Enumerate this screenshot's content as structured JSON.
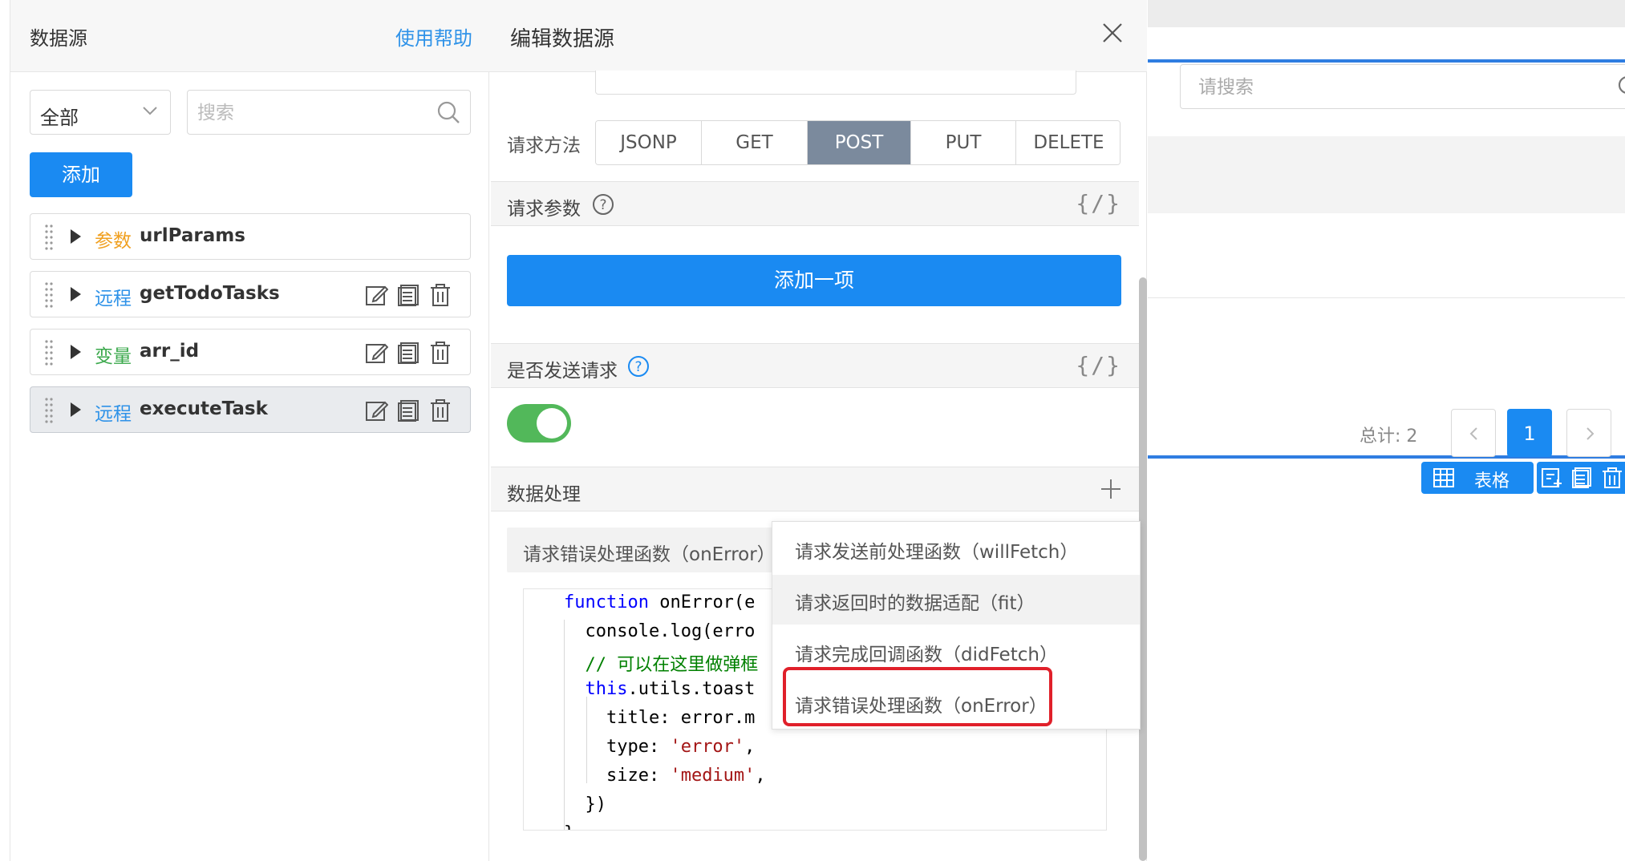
{
  "left": {
    "title": "数据源",
    "help": "使用帮助",
    "filter_value": "全部",
    "search_placeholder": "搜索",
    "add_button": "添加",
    "items": [
      {
        "kind": "参数",
        "kind_color": "#f0a020",
        "name": "urlParams",
        "has_actions": false
      },
      {
        "kind": "远程",
        "kind_color": "#2e92e8",
        "name": "getTodoTasks",
        "has_actions": true
      },
      {
        "kind": "变量",
        "kind_color": "#3aa84b",
        "name": "arr_id",
        "has_actions": true
      },
      {
        "kind": "远程",
        "kind_color": "#2e92e8",
        "name": "executeTask",
        "has_actions": true
      }
    ]
  },
  "editor": {
    "title": "编辑数据源",
    "method_label": "请求方法",
    "methods": [
      "JSONP",
      "GET",
      "POST",
      "PUT",
      "DELETE"
    ],
    "selected_method": "POST",
    "params_label": "请求参数",
    "code_toggle": "{/}",
    "add_item_button": "添加一项",
    "send_label": "是否发送请求",
    "send_enabled": true,
    "processing_label": "数据处理",
    "onerror_tab": "请求错误处理函数（onError）",
    "code_lines": [
      "function onError(e",
      "  console.log(erro",
      "  // 可以在这里做弹框",
      "  this.utils.toast",
      "    title: error.m",
      "    type: 'error',",
      "    size: 'medium',",
      "  })",
      "}"
    ]
  },
  "dropdown": {
    "items": [
      "请求发送前处理函数（willFetch）",
      "请求返回时的数据适配（fit）",
      "请求完成回调函数（didFetch）",
      "请求错误处理函数（onError）"
    ],
    "hover_index": 1,
    "highlighted_index": 3
  },
  "canvas": {
    "search_placeholder": "请搜索",
    "total_label": "总计: 2",
    "current_page": "1",
    "table_chip": "表格"
  },
  "colors": {
    "primary": "#1a8af2",
    "selected_method": "#7b8a9d",
    "toggle_on": "#52b85a",
    "highlight": "#e0202a"
  }
}
